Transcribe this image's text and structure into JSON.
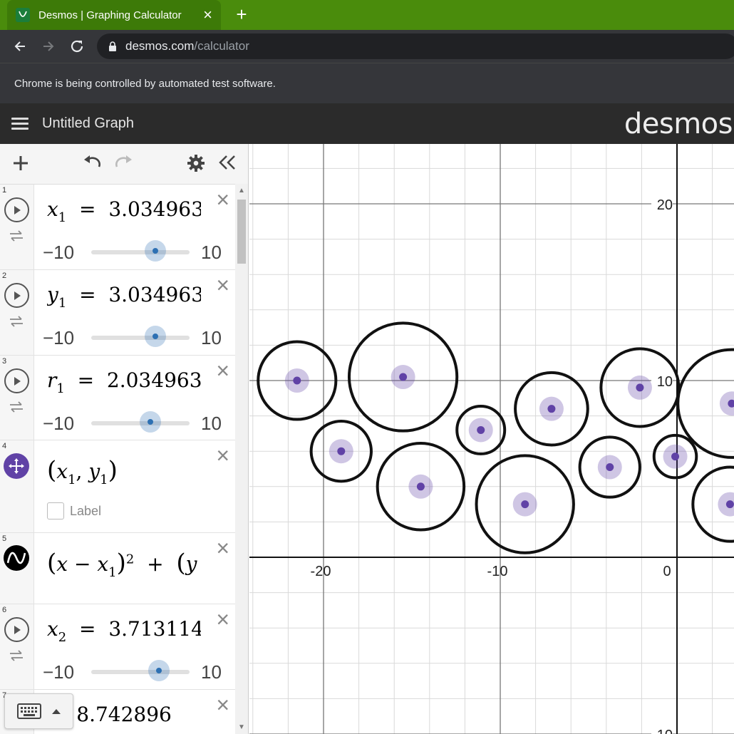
{
  "browser": {
    "tab_title": "Desmos | Graphing Calculator",
    "url_host": "desmos.com",
    "url_path": "/calculator",
    "infobar_text": "Chrome is being controlled by automated test software."
  },
  "app": {
    "graph_title": "Untitled Graph",
    "logo": "desmos"
  },
  "expressions": [
    {
      "num": "1",
      "var": "x",
      "sub": "1",
      "value": "3.034963",
      "min": "−10",
      "max": "10",
      "slider_value": 3.034963
    },
    {
      "num": "2",
      "var": "y",
      "sub": "1",
      "value": "3.034963",
      "min": "−10",
      "max": "10",
      "slider_value": 3.034963
    },
    {
      "num": "3",
      "var": "r",
      "sub": "1",
      "value": "2.034963",
      "min": "−10",
      "max": "10",
      "slider_value": 2.034963
    },
    {
      "num": "4",
      "label_text": "Label"
    },
    {
      "num": "5"
    },
    {
      "num": "6",
      "var": "x",
      "sub": "2",
      "value": "3.713114",
      "min": "−10",
      "max": "10",
      "slider_value": 3.713114
    },
    {
      "num": "7",
      "value": "8.742896"
    }
  ],
  "graph": {
    "x_ticks": [
      "-20",
      "-10",
      "0"
    ],
    "y_ticks": [
      "20",
      "10",
      "-10"
    ],
    "circles": [
      {
        "cx": -21.5,
        "cy": 10,
        "r": 2.2
      },
      {
        "cx": -15.5,
        "cy": 10.2,
        "r": 3.05
      },
      {
        "cx": -19,
        "cy": 6,
        "r": 1.7
      },
      {
        "cx": -14.5,
        "cy": 4,
        "r": 2.45
      },
      {
        "cx": -11.1,
        "cy": 7.2,
        "r": 1.35
      },
      {
        "cx": -8.6,
        "cy": 3,
        "r": 2.75
      },
      {
        "cx": -7.1,
        "cy": 8.4,
        "r": 2.05
      },
      {
        "cx": -3.8,
        "cy": 5.1,
        "r": 1.7
      },
      {
        "cx": -2.1,
        "cy": 9.6,
        "r": 2.2
      },
      {
        "cx": -0.1,
        "cy": 5.7,
        "r": 1.2
      },
      {
        "cx": 3.1,
        "cy": 8.7,
        "r": 3.05
      },
      {
        "cx": 3.0,
        "cy": 3.0,
        "r": 2.1
      }
    ]
  }
}
